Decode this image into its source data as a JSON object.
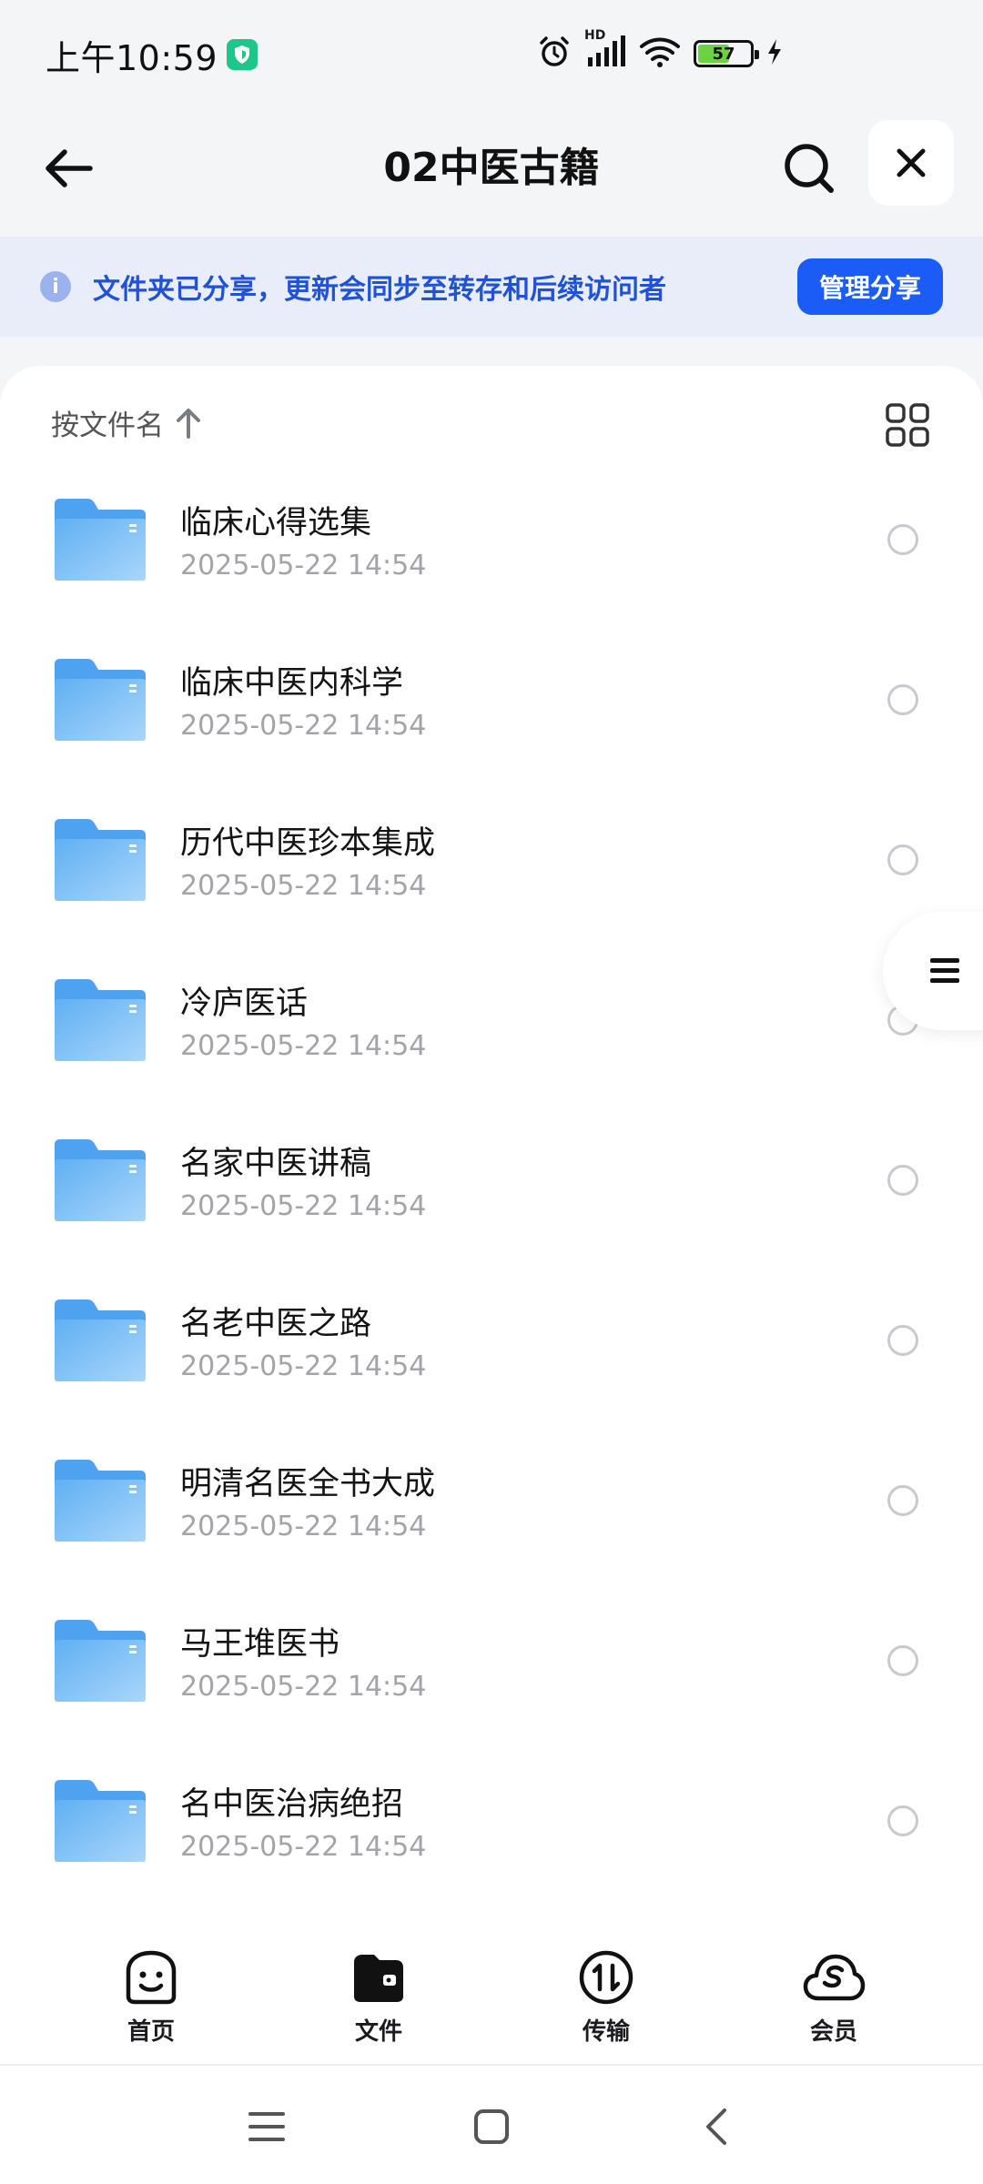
{
  "status_bar": {
    "time": "上午10:59",
    "network_label": "HD",
    "battery_level": "57"
  },
  "header": {
    "title": "02中医古籍"
  },
  "share_banner": {
    "message": "文件夹已分享，更新会同步至转存和后续访问者",
    "manage_button": "管理分享"
  },
  "sort": {
    "label": "按文件名"
  },
  "files": [
    {
      "name": "临床心得选集",
      "date": "2025-05-22 14:54"
    },
    {
      "name": "临床中医内科学",
      "date": "2025-05-22 14:54"
    },
    {
      "name": "历代中医珍本集成",
      "date": "2025-05-22 14:54"
    },
    {
      "name": "冷庐医话",
      "date": "2025-05-22 14:54"
    },
    {
      "name": "名家中医讲稿",
      "date": "2025-05-22 14:54"
    },
    {
      "name": "名老中医之路",
      "date": "2025-05-22 14:54"
    },
    {
      "name": "明清名医全书大成",
      "date": "2025-05-22 14:54"
    },
    {
      "name": "马王堆医书",
      "date": "2025-05-22 14:54"
    },
    {
      "name": "名中医治病绝招",
      "date": "2025-05-22 14:54"
    }
  ],
  "bottom_nav": [
    {
      "label": "首页",
      "icon": "smile-home-icon"
    },
    {
      "label": "文件",
      "icon": "wallet-files-icon"
    },
    {
      "label": "传输",
      "icon": "transfer-icon"
    },
    {
      "label": "会员",
      "icon": "vip-cloud-icon"
    }
  ],
  "colors": {
    "accent": "#1a5cf5",
    "banner_bg": "#e8edf9",
    "banner_text": "#2152d6",
    "folder": "#6cb8f5"
  }
}
